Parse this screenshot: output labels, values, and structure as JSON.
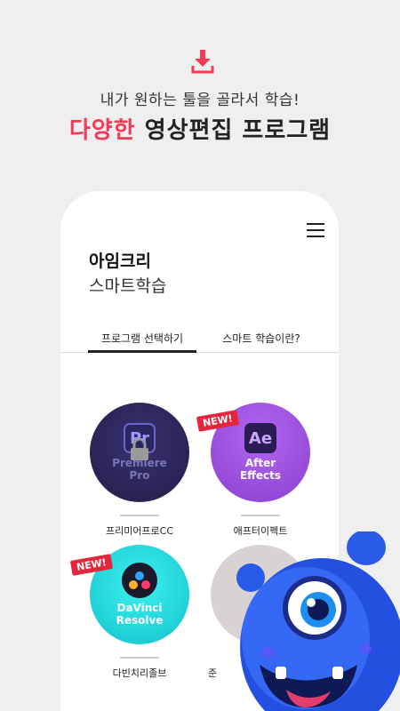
{
  "header": {
    "line1": "내가 원하는 툴을 골라서 학습!",
    "line2_accent": "다양한",
    "line2_rest": " 영상편집 프로그램"
  },
  "app": {
    "brand": "아임크리",
    "subbrand": "스마트학습",
    "tabs": [
      {
        "label": "프로그램 선택하기",
        "active": true
      },
      {
        "label": "스마트 학습이란?",
        "active": false
      }
    ],
    "programs": [
      {
        "label": "프리미어프로CC",
        "circle_text_1": "Premiere",
        "circle_text_2": "Pro",
        "logo": "Pr",
        "badge": "",
        "locked": true
      },
      {
        "label": "애프터이펙트",
        "circle_text_1": "After",
        "circle_text_2": "Effects",
        "logo": "Ae",
        "badge": "NEW!",
        "locked": false
      },
      {
        "label": "다빈치리졸브",
        "circle_text_1": "DaVinci",
        "circle_text_2": "Resolve",
        "logo": "",
        "badge": "NEW!",
        "locked": false
      },
      {
        "label": "준",
        "circle_text_1": "",
        "circle_text_2": "",
        "logo": "",
        "badge": "",
        "locked": false
      }
    ]
  },
  "colors": {
    "accent": "#f23c57",
    "premiere": "#2b2358",
    "after_effects": "#9a4cd9",
    "davinci": "#1ed0d8",
    "mascot": "#2350e0"
  },
  "icons": {
    "download": "download-icon",
    "menu": "hamburger-menu-icon",
    "lock": "lock-icon"
  }
}
